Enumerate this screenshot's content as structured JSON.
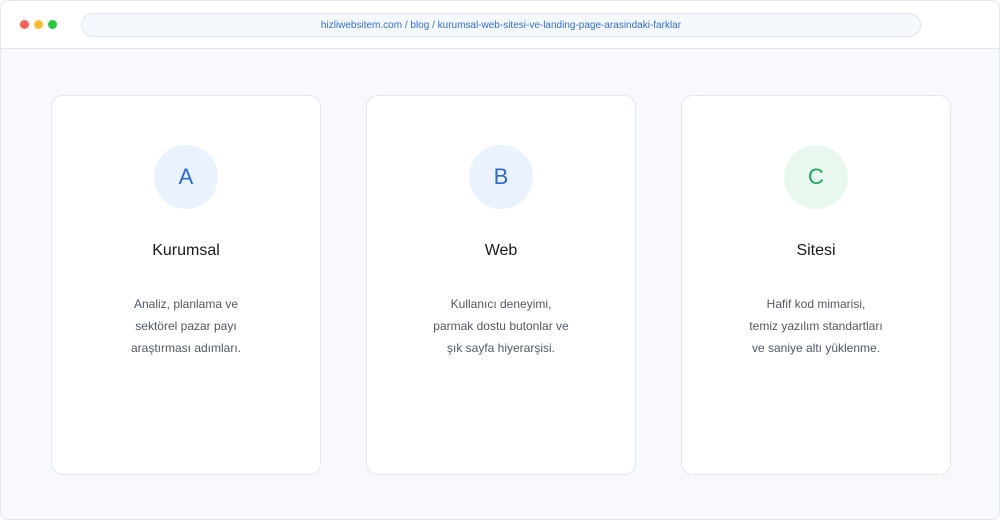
{
  "browser": {
    "url": "hizliwebsitem.com / blog / kurumsal-web-sitesi-ve-landing-page-arasindaki-farklar",
    "dots": [
      "close",
      "minimize",
      "maximize"
    ]
  },
  "cards": [
    {
      "letter": "A",
      "title": "Kurumsal",
      "desc": [
        "Analiz, planlama ve",
        "sektörel pazar payı",
        "araştırması adımları."
      ]
    },
    {
      "letter": "B",
      "title": "Web",
      "desc": [
        "Kullanıcı deneyimi,",
        "parmak dostu butonlar ve",
        "şık sayfa hiyerarşisi."
      ]
    },
    {
      "letter": "C",
      "title": "Sitesi",
      "desc": [
        "Hafif kod mimarisi,",
        "temiz yazılım standartları",
        "ve saniye altı yüklenme."
      ]
    }
  ],
  "colors": {
    "accent_blue": "#2a6ad9",
    "accent_green": "#25a562",
    "badge_blue_bg": "#eaf2fd",
    "badge_green_bg": "#e8f8ee"
  }
}
